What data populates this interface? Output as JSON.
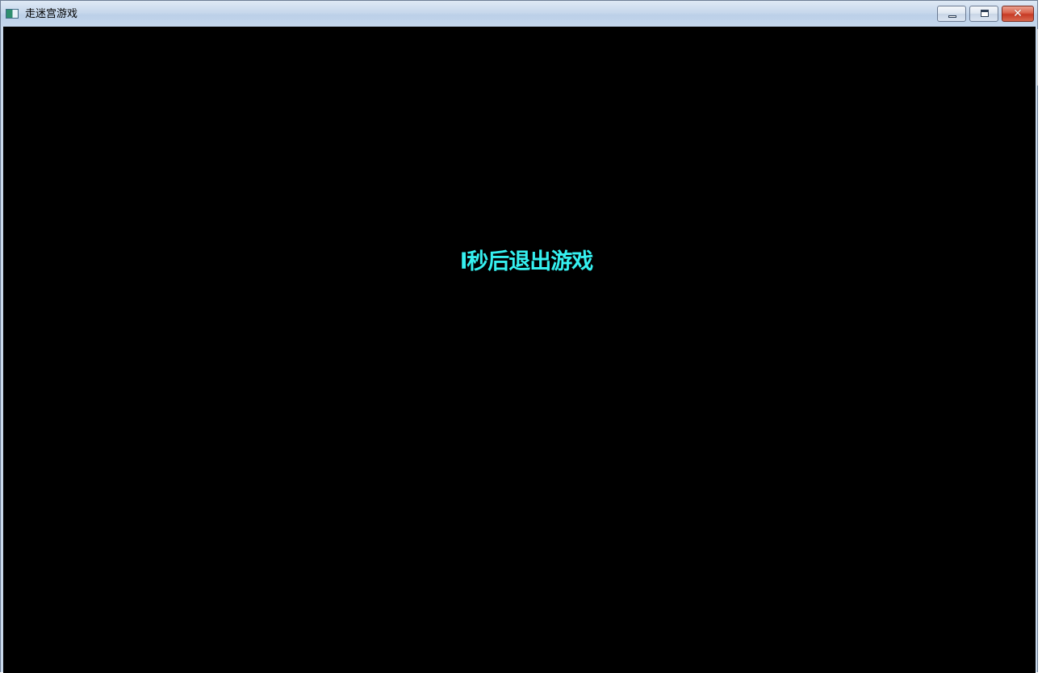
{
  "window": {
    "title": "走迷宫游戏",
    "icon": "app-window-icon",
    "controls": {
      "minimize_icon": "minimize-icon",
      "maximize_icon": "maximize-icon",
      "close_glyph": "✕"
    }
  },
  "game": {
    "message": "l秒后退出游戏",
    "message_color": "#35f0f0",
    "background_color": "#000000"
  }
}
